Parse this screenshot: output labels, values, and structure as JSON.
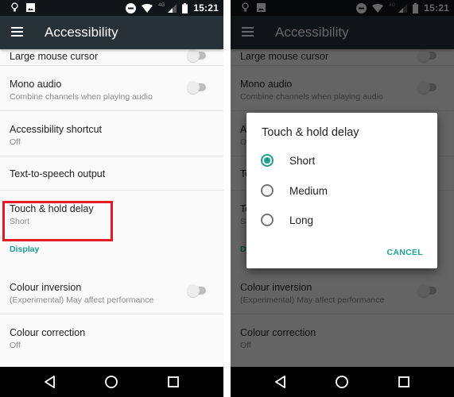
{
  "status_bar": {
    "time": "15:21",
    "network_label": "4G",
    "left_icons": [
      "lightbulb-icon",
      "image-icon"
    ],
    "right_icons": [
      "do-not-disturb-icon",
      "wifi-icon",
      "signal-icon",
      "battery-icon"
    ]
  },
  "app_bar": {
    "title": "Accessibility",
    "menu_icon": "hamburger-menu-icon"
  },
  "settings_list": [
    {
      "title": "Large mouse cursor",
      "toggle": false
    },
    {
      "title": "Mono audio",
      "summary": "Combine channels when playing audio",
      "toggle": false
    },
    {
      "title": "Accessibility shortcut",
      "summary": "Off"
    },
    {
      "title": "Text-to-speech output"
    },
    {
      "title": "Touch & hold delay",
      "summary": "Short",
      "highlighted": true
    },
    {
      "category": "Display"
    },
    {
      "title": "Colour inversion",
      "summary": "(Experimental) May affect performance",
      "toggle": false
    },
    {
      "title": "Colour correction",
      "summary": "Off"
    }
  ],
  "dialog": {
    "title": "Touch & hold delay",
    "options": [
      {
        "label": "Short",
        "selected": true
      },
      {
        "label": "Medium",
        "selected": false
      },
      {
        "label": "Long",
        "selected": false
      }
    ],
    "cancel_label": "CANCEL"
  },
  "nav_bar": {
    "icons": [
      "back-icon",
      "home-icon",
      "recents-icon"
    ]
  },
  "colors": {
    "accent": "#1fa090",
    "app_bar": "#263238",
    "status_bar": "#101517",
    "highlight": "#e31b23"
  }
}
